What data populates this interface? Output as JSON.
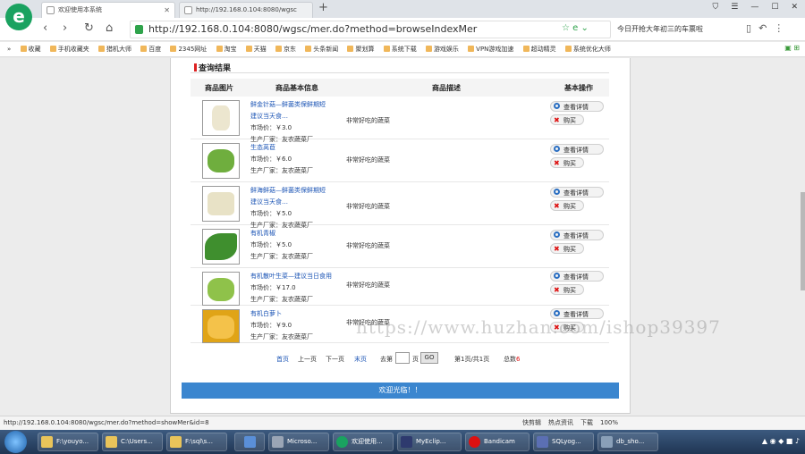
{
  "browser": {
    "active_tab_title": "欢迎使用本系统",
    "inactive_tab_title": "http://192.168.0.104:8080/wgsc",
    "url": "http://192.168.0.104:8080/wgsc/mer.do?method=browseIndexMer",
    "search_text": "今日开抢大年初三的车票啦",
    "bookmarks": [
      "收藏",
      "手机收藏夹",
      "猎机大师",
      "百度",
      "2345网址",
      "淘宝",
      "天猫",
      "京东",
      "头条新闻",
      "聚划算",
      "系统下载",
      "游戏娱乐",
      "VPN游戏加速",
      "超动精灵",
      "系统优化大师"
    ]
  },
  "page": {
    "section_title": "查询结果",
    "headers": [
      "商品图片",
      "商品基本信息",
      "商品描述",
      "基本操作"
    ],
    "price_label": "市场价：",
    "maker_label": "生产厂家：",
    "detail_label": "查看详情",
    "buy_label": "购买",
    "products": [
      {
        "name_lines": [
          "鲜金针菇—鲜菌类保鲜期短",
          "建议当天食…"
        ],
        "price": "￥3.0",
        "maker": "友农蔬菜厂",
        "desc": "非常好吃的蔬菜",
        "image": "enoki"
      },
      {
        "name_lines": [
          "生态莴苣"
        ],
        "price": "￥6.0",
        "maker": "友农蔬菜厂",
        "desc": "非常好吃的蔬菜",
        "image": "lettuce"
      },
      {
        "name_lines": [
          "鲜海鲜菇—鲜菌类保鲜期短",
          "建议当天食…"
        ],
        "price": "￥5.0",
        "maker": "友农蔬菜厂",
        "desc": "非常好吃的蔬菜",
        "image": "mushroom"
      },
      {
        "name_lines": [
          "有机青椒"
        ],
        "price": "￥5.0",
        "maker": "友农蔬菜厂",
        "desc": "非常好吃的蔬菜",
        "image": "pepper"
      },
      {
        "name_lines": [
          "有机散叶生菜—建议当日食用"
        ],
        "price": "￥17.0",
        "maker": "友农蔬菜厂",
        "desc": "非常好吃的蔬菜",
        "image": "leaf-lettuce"
      },
      {
        "name_lines": [
          "有机白萝卜"
        ],
        "price": "￥9.0",
        "maker": "友农蔬菜厂",
        "desc": "非常好吃的蔬菜",
        "image": "radish"
      }
    ],
    "pagination": {
      "first": "首页",
      "prev": "上一页",
      "next": "下一页",
      "last": "末页",
      "goto_prefix": "去第",
      "goto_suffix": "页",
      "go": "GO",
      "page_info": "第1页/共1页",
      "total_prefix": "总数",
      "total": "6"
    },
    "welcome": "欢迎光临！！",
    "watermark": "https://www.huzhan.com/ishop39397"
  },
  "status": {
    "url": "http://192.168.0.104:8080/wgsc/mer.do?method=showMer&id=8",
    "right_items": [
      "快剪辑",
      "热点资讯",
      "下载",
      "100%"
    ]
  },
  "taskbar": {
    "items": [
      "F:\\youyo...",
      "C:\\Users...",
      "F:\\sql\\s...",
      "Microso...",
      "欢迎使用...",
      "MyEclip...",
      "Bandicam",
      "SQLyog...",
      "db_sho..."
    ]
  },
  "colors": {
    "link": "#1b54b5",
    "footer": "#3b86cf",
    "browser_logo": "#1aa260"
  }
}
